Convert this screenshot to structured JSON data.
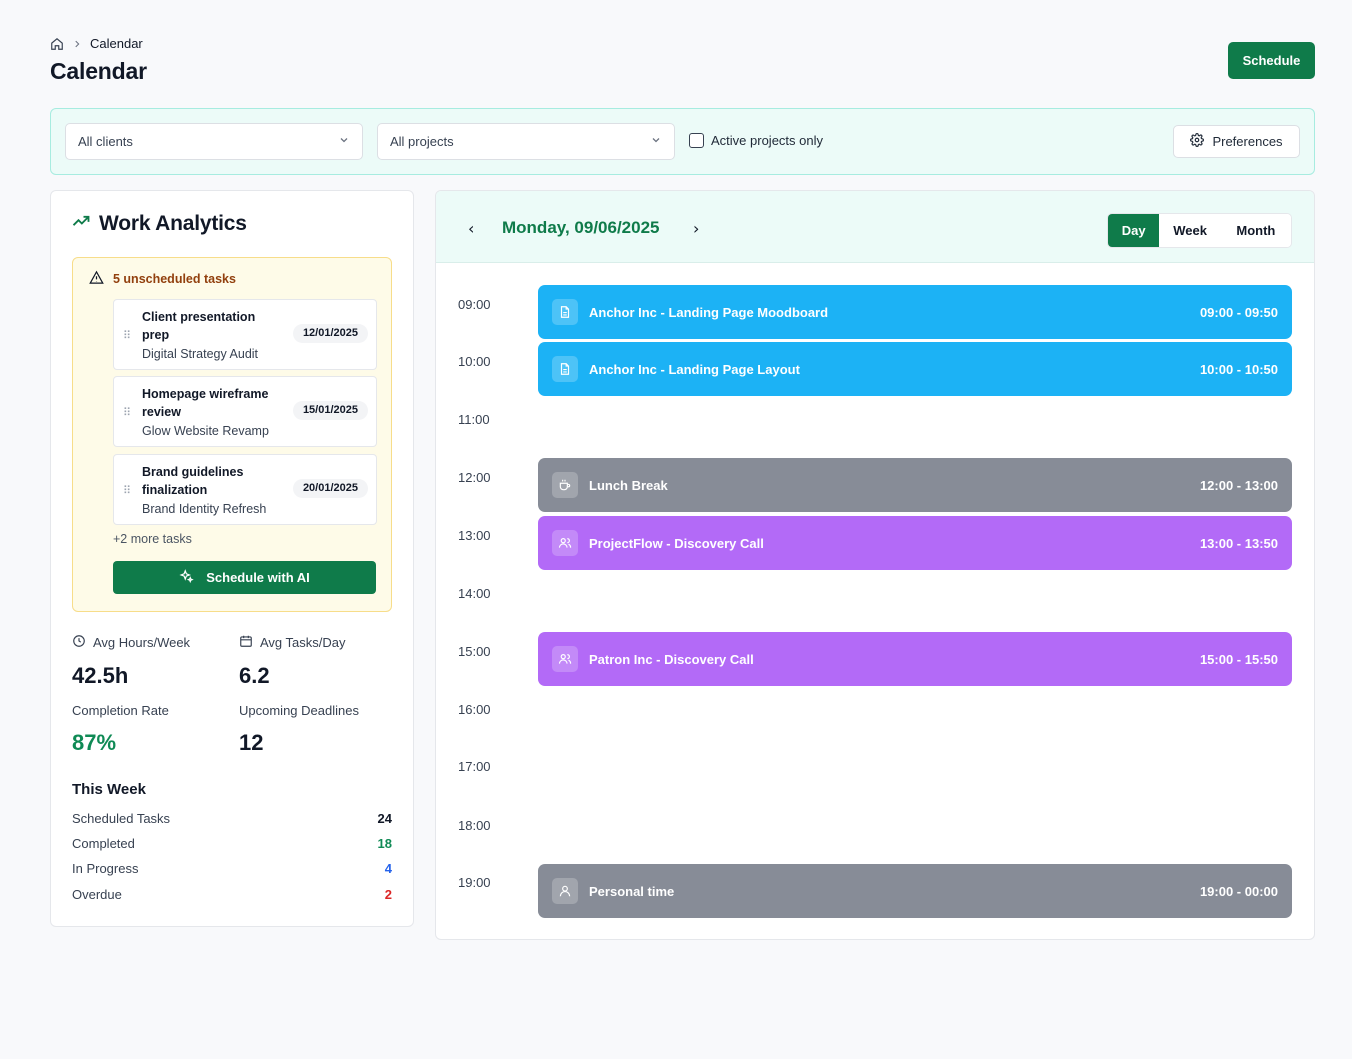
{
  "breadcrumb": {
    "current": "Calendar"
  },
  "page_title": "Calendar",
  "header": {
    "schedule_label": "Schedule"
  },
  "filters": {
    "clients": "All clients",
    "projects": "All projects",
    "active_only": "Active projects only",
    "preferences": "Preferences"
  },
  "analytics": {
    "title": "Work Analytics",
    "unscheduled": {
      "heading": "5 unscheduled tasks",
      "tasks": [
        {
          "title": "Client presentation prep",
          "project": "Digital Strategy Audit",
          "date": "12/01/2025"
        },
        {
          "title": "Homepage wireframe review",
          "project": "Glow Website Revamp",
          "date": "15/01/2025"
        },
        {
          "title": "Brand guidelines finalization",
          "project": "Brand Identity Refresh",
          "date": "20/01/2025"
        }
      ],
      "more": "+2 more tasks",
      "ai_button": "Schedule with AI"
    },
    "stats": {
      "avg_hours_label": "Avg Hours/Week",
      "avg_hours": "42.5h",
      "avg_tasks_label": "Avg Tasks/Day",
      "avg_tasks": "6.2",
      "completion_label": "Completion Rate",
      "completion": "87%",
      "deadlines_label": "Upcoming Deadlines",
      "deadlines": "12"
    },
    "week": {
      "title": "This Week",
      "rows": [
        {
          "label": "Scheduled Tasks",
          "value": "24",
          "color": "#111827"
        },
        {
          "label": "Completed",
          "value": "18",
          "color": "#0f8a55"
        },
        {
          "label": "In Progress",
          "value": "4",
          "color": "#2563eb"
        },
        {
          "label": "Overdue",
          "value": "2",
          "color": "#dc2626"
        }
      ]
    }
  },
  "calendar": {
    "date": "Monday, 09/06/2025",
    "prev_icon": "‹",
    "next_icon": "›",
    "views": [
      "Day",
      "Week",
      "Month"
    ],
    "active_view": "Day",
    "hours": [
      "09:00",
      "10:00",
      "11:00",
      "12:00",
      "13:00",
      "14:00",
      "15:00",
      "16:00",
      "17:00",
      "18:00",
      "19:00"
    ],
    "events": [
      {
        "title": "Anchor Inc - Landing Page Moodboard",
        "time": "09:00 - 09:50",
        "type": "task",
        "icon": "document-icon",
        "color": "#1cb2f5"
      },
      {
        "title": "Anchor Inc - Landing Page Layout",
        "time": "10:00 - 10:50",
        "type": "task",
        "icon": "document-icon",
        "color": "#1cb2f5"
      },
      {
        "title": "Lunch Break",
        "time": "12:00 - 13:00",
        "type": "break",
        "icon": "coffee-icon",
        "color": "#878c97"
      },
      {
        "title": "ProjectFlow - Discovery Call",
        "time": "13:00 - 13:50",
        "type": "meeting",
        "icon": "users-icon",
        "color": "#b36af7"
      },
      {
        "title": "Patron Inc - Discovery Call",
        "time": "15:00 - 15:50",
        "type": "meeting",
        "icon": "users-icon",
        "color": "#b36af7"
      },
      {
        "title": "Personal time",
        "time": "19:00 - 00:00",
        "type": "personal",
        "icon": "user-icon",
        "color": "#878c97"
      }
    ]
  },
  "colors": {
    "brand": "#0f7b4a",
    "accent_bg": "#ecfbf8"
  }
}
